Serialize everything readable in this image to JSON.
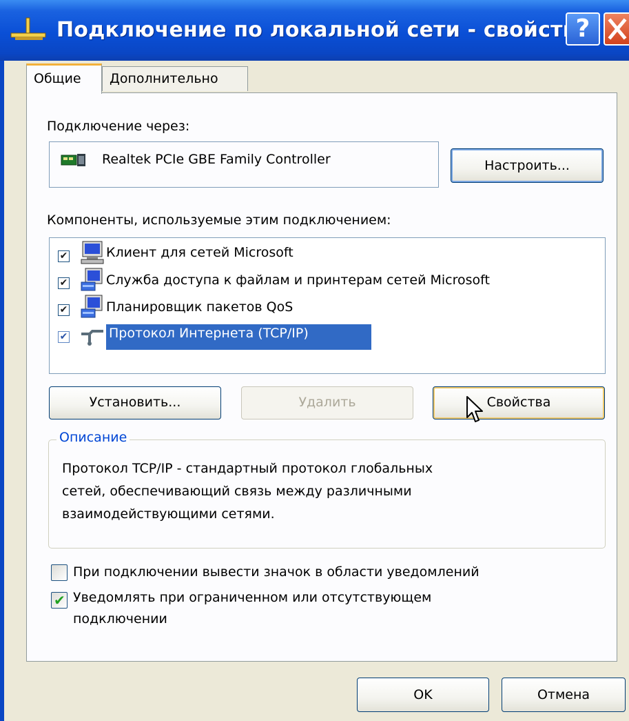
{
  "window": {
    "title": "Подключение по локальной сети - свойства",
    "help_glyph": "?",
    "title_icon": "network-connection-icon",
    "colors": {
      "titlebar": "#0a4fd6",
      "dialog_bg": "#ece9d8",
      "selection": "#316ac5",
      "group_title": "#0046d5"
    }
  },
  "tabs": [
    {
      "label": "Общие",
      "active": true
    },
    {
      "label": "Дополнительно",
      "active": false
    }
  ],
  "connect_using": {
    "label": "Подключение через:",
    "adapter_name": "Realtek PCIe GBE Family Controller",
    "adapter_icon": "network-card-icon",
    "configure_button": "Настроить..."
  },
  "components": {
    "label": "Компоненты, используемые этим подключением:",
    "items": [
      {
        "label": "Клиент для сетей Microsoft",
        "checked": true,
        "icon": "computer-network-icon",
        "selected": false
      },
      {
        "label": "Служба доступа к файлам и принтерам сетей Microsoft",
        "checked": true,
        "icon": "computer-network-icon",
        "selected": false
      },
      {
        "label": "Планировщик пакетов QoS",
        "checked": true,
        "icon": "computer-network-icon",
        "selected": false
      },
      {
        "label": "Протокол Интернета (TCP/IP)",
        "checked": true,
        "icon": "network-protocol-icon",
        "selected": true
      }
    ],
    "check_glyph": "✔",
    "install_button": "Установить...",
    "remove_button": "Удалить",
    "properties_button": "Свойства"
  },
  "description": {
    "title": "Описание",
    "lines": [
      "Протокол TCP/IP - стандартный протокол глобальных",
      "сетей, обеспечивающий связь между различными",
      "взаимодействующими сетями."
    ]
  },
  "options": {
    "show_icon": {
      "label": "При подключении вывести значок в области уведомлений",
      "checked": false
    },
    "notify": {
      "label_line1": "Уведомлять при ограниченном или отсутствующем",
      "label_line2": "подключении",
      "checked": true
    },
    "check_glyph": "✔"
  },
  "footer": {
    "ok_button": "OK",
    "cancel_button": "Отмена"
  }
}
